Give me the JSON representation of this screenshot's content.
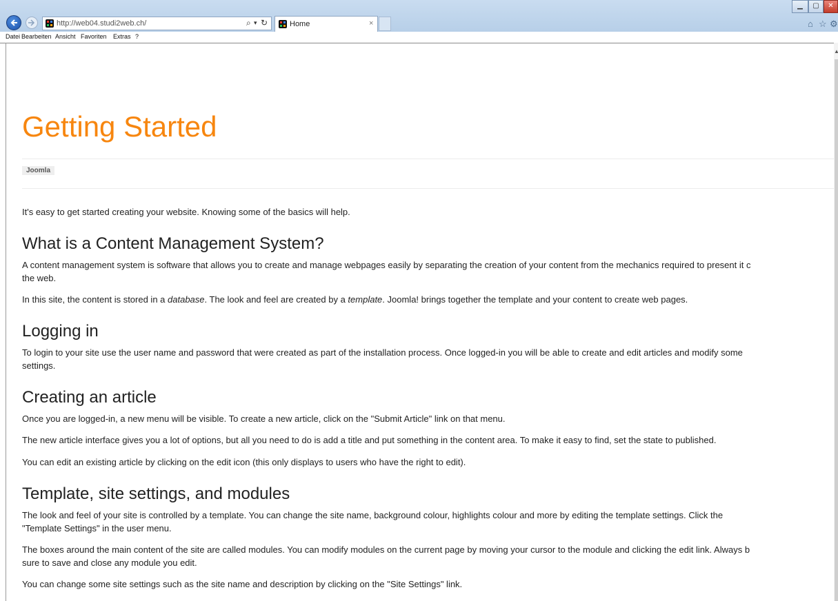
{
  "browser": {
    "url": "http://web04.studi2web.ch/",
    "tab_title": "Home",
    "tab_close": "×",
    "menu": [
      "Datei",
      "Bearbeiten",
      "Ansicht",
      "Favoriten",
      "Extras",
      "?"
    ],
    "icons": [
      "back-arrow-icon",
      "forward-arrow-icon",
      "search-icon",
      "refresh-icon",
      "home-icon",
      "favorites-star-icon",
      "settings-gear-icon"
    ],
    "accent_color": "#f7860f"
  },
  "article": {
    "title": "Getting Started",
    "tag": "Joomla",
    "intro": "It's easy to get started creating your website. Knowing some of the basics will help.",
    "sections": [
      {
        "heading": "What is a Content Management System?",
        "paragraphs": [
          "A content management system is software that allows you to create and manage webpages easily by separating the creation of your content from the mechanics required to present it c",
          "the web.",
          "In this site, the content is stored in a ",
          "database",
          ". The look and feel are created by a ",
          "template",
          ". Joomla! brings together the template and your content to create web pages."
        ]
      },
      {
        "heading": "Logging in",
        "paragraphs": [
          "To login to your site use the user name and password that were created as part of the installation process. Once logged-in you will be able to create and edit articles and modify some",
          "settings."
        ]
      },
      {
        "heading": "Creating an article",
        "paragraphs": [
          "Once you are logged-in, a new menu will be visible. To create a new article, click on the \"Submit Article\" link on that menu.",
          "The new article interface gives you a lot of options, but all you need to do is add a title and put something in the content area. To make it easy to find, set the state to published.",
          "You can edit an existing article by clicking on the edit icon (this only displays to users who have the right to edit)."
        ]
      },
      {
        "heading": "Template, site settings, and modules",
        "paragraphs": [
          "The look and feel of your site is controlled by a template. You can change the site name, background colour, highlights colour and more by editing the template settings. Click the",
          "\"Template Settings\" in the user menu.",
          "The boxes around the main content of the site are called modules. You can modify modules on the current page by moving your cursor to the module and clicking the edit link. Always b",
          "sure to save and close any module you edit.",
          "You can change some site settings such as the site name and description by clicking on the \"Site Settings\" link."
        ]
      }
    ]
  }
}
